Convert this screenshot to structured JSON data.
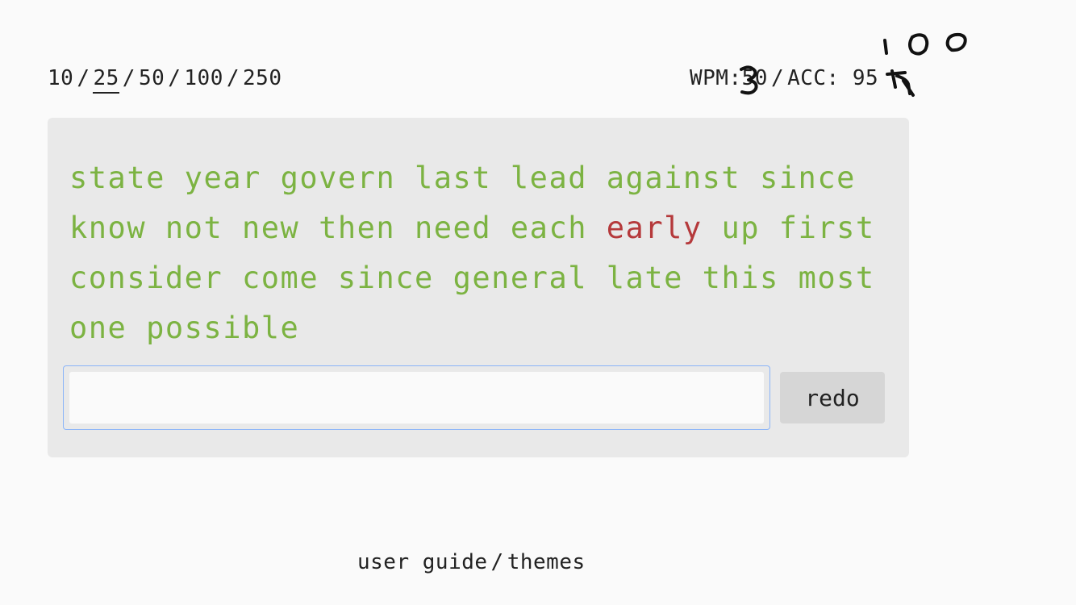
{
  "word_counts": {
    "options": [
      "10",
      "25",
      "50",
      "100",
      "250"
    ],
    "separator": "/",
    "selected": "25"
  },
  "stats": {
    "wpm_label": "WPM:",
    "wpm_value": "50",
    "separator": "/",
    "acc_label": "ACC:",
    "acc_value": "95"
  },
  "handwritten_overlay": "3 100",
  "text": {
    "words": [
      {
        "w": "state",
        "state": "correct"
      },
      {
        "w": "year",
        "state": "correct"
      },
      {
        "w": "govern",
        "state": "correct"
      },
      {
        "w": "last",
        "state": "correct"
      },
      {
        "w": "lead",
        "state": "correct"
      },
      {
        "w": "against",
        "state": "correct"
      },
      {
        "w": "since",
        "state": "correct"
      },
      {
        "w": "know",
        "state": "correct"
      },
      {
        "w": "not",
        "state": "correct"
      },
      {
        "w": "new",
        "state": "correct"
      },
      {
        "w": "then",
        "state": "correct"
      },
      {
        "w": "need",
        "state": "correct"
      },
      {
        "w": "each",
        "state": "correct"
      },
      {
        "w": "early",
        "state": "wrong"
      },
      {
        "w": "up",
        "state": "correct"
      },
      {
        "w": "first",
        "state": "correct"
      },
      {
        "w": "consider",
        "state": "correct"
      },
      {
        "w": "come",
        "state": "correct"
      },
      {
        "w": "since",
        "state": "correct"
      },
      {
        "w": "general",
        "state": "correct"
      },
      {
        "w": "late",
        "state": "correct"
      },
      {
        "w": "this",
        "state": "correct"
      },
      {
        "w": "most",
        "state": "correct"
      },
      {
        "w": "one",
        "state": "correct"
      },
      {
        "w": "possible",
        "state": "correct"
      }
    ]
  },
  "typing_input": {
    "value": "",
    "placeholder": ""
  },
  "redo_label": "redo",
  "footer": {
    "user_guide": "user guide",
    "separator": "/",
    "themes": "themes"
  },
  "colors": {
    "correct": "#7cb342",
    "wrong": "#b5393b",
    "card_bg": "#e9e9e9",
    "page_bg": "#fafafa",
    "input_focus": "#8ab4f8"
  }
}
